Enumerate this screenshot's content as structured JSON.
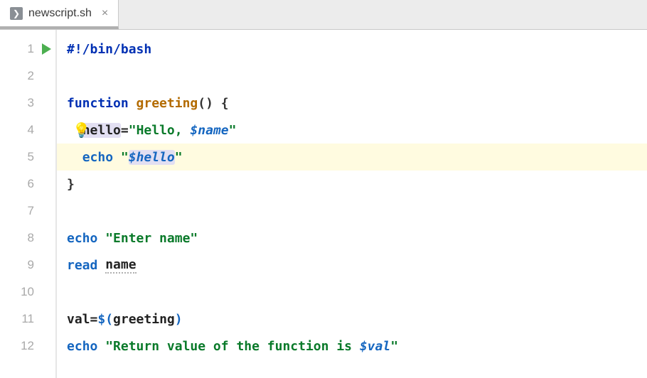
{
  "tab": {
    "filename": "newscript.sh",
    "filetype_glyph": "❯"
  },
  "editor": {
    "highlighted_line": 5,
    "run_icon_line": 1,
    "line_count": 12,
    "code": {
      "l1": {
        "keyword": "#!/bin/bash"
      },
      "l3": {
        "kw": "function",
        "fn": "greeting",
        "parens": "()",
        "brace": " {"
      },
      "l4": {
        "indent": "  ",
        "var_hl": "hello",
        "eq": "=",
        "str_open": "\"",
        "str_body": "Hello, ",
        "str_var": "$name",
        "str_close": "\""
      },
      "l5": {
        "indent": "  ",
        "cmd": "echo",
        "sp": " ",
        "str_open": "\"",
        "str_var_hl": "$hello",
        "str_close": "\""
      },
      "l6": {
        "brace": "}"
      },
      "l8": {
        "cmd": "echo",
        "sp": " ",
        "str": "\"Enter name\""
      },
      "l9": {
        "cmd": "read",
        "sp": " ",
        "arg": "name"
      },
      "l11": {
        "lhs": "val",
        "eq": "=",
        "dollar_open": "$(",
        "call": "greeting",
        "close": ")"
      },
      "l12": {
        "cmd": "echo",
        "sp": " ",
        "str_open": "\"",
        "str_body": "Return value of the function is ",
        "str_var": "$val",
        "str_close": "\""
      }
    }
  }
}
